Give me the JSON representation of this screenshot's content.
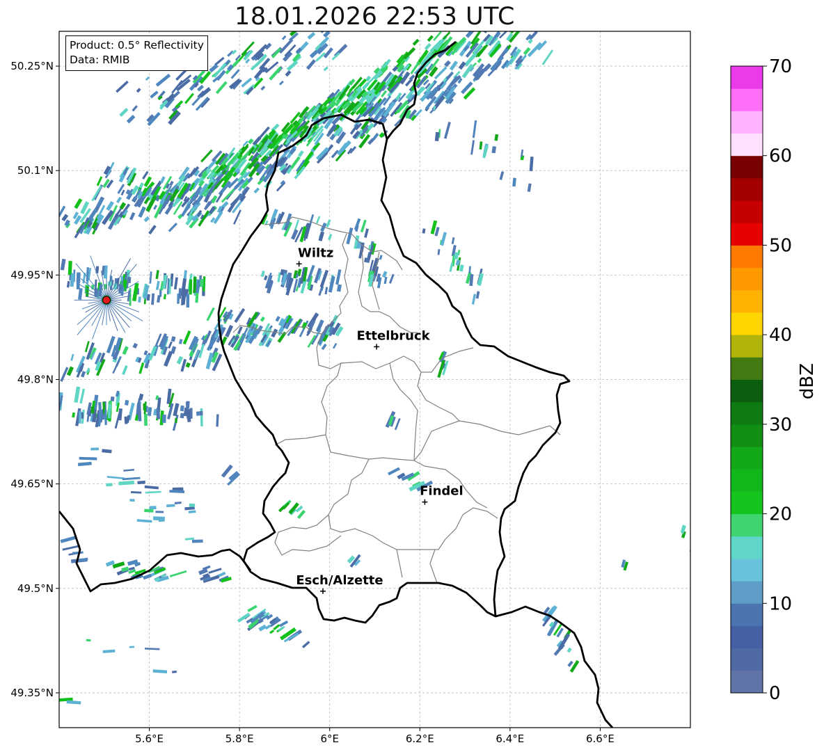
{
  "title": "18.01.2026 22:53 UTC",
  "info": {
    "product": "Product: 0.5° Reflectivity",
    "data_source": "Data: RMIB"
  },
  "map": {
    "extent": {
      "lon_min": 5.4,
      "lon_max": 6.8,
      "lat_min": 49.3,
      "lat_max": 50.3
    },
    "lon_ticks": [
      {
        "value": 5.6,
        "label": "5.6°E"
      },
      {
        "value": 5.8,
        "label": "5.8°E"
      },
      {
        "value": 6.0,
        "label": "6°E"
      },
      {
        "value": 6.2,
        "label": "6.2°E"
      },
      {
        "value": 6.4,
        "label": "6.4°E"
      },
      {
        "value": 6.6,
        "label": "6.6°E"
      }
    ],
    "lat_ticks": [
      {
        "value": 50.25,
        "label": "50.25°N"
      },
      {
        "value": 50.1,
        "label": "50.1°N"
      },
      {
        "value": 49.95,
        "label": "49.95°N"
      },
      {
        "value": 49.8,
        "label": "49.8°N"
      },
      {
        "value": 49.65,
        "label": "49.65°N"
      },
      {
        "value": 49.5,
        "label": "49.5°N"
      },
      {
        "value": 49.35,
        "label": "49.35°N"
      }
    ],
    "radar_site": {
      "lon": 5.505,
      "lat": 49.914
    },
    "cities": [
      {
        "name": "Wiltz",
        "lon": 5.932,
        "lat": 49.966
      },
      {
        "name": "Ettelbruck",
        "lon": 6.104,
        "lat": 49.847
      },
      {
        "name": "Findel",
        "lon": 6.211,
        "lat": 49.624
      },
      {
        "name": "Esch/Alzette",
        "lon": 5.985,
        "lat": 49.496
      }
    ],
    "colors": {
      "border": "#000000",
      "cantons": "#808080",
      "grid": "#bbbbbb",
      "radar_site": "#e31a1c"
    }
  },
  "colorbar": {
    "label": "dBZ",
    "min": 0,
    "max": 70,
    "tick_values": [
      0,
      10,
      20,
      30,
      40,
      50,
      60,
      70
    ],
    "colors": [
      "#6174a8",
      "#516aa3",
      "#4560a4",
      "#4a75b0",
      "#5d9dc8",
      "#68c2dc",
      "#5fd6c8",
      "#3fd470",
      "#16c41e",
      "#12b81a",
      "#12a818",
      "#118e14",
      "#0f7a12",
      "#0b5e0e",
      "#447a12",
      "#b1b40a",
      "#ffd500",
      "#ffb300",
      "#ff9900",
      "#ff7a00",
      "#e60000",
      "#c40000",
      "#a30000",
      "#780000",
      "#ffe0ff",
      "#ffb3ff",
      "#ff6ef7",
      "#ea3aea"
    ]
  },
  "echo_colors": [
    "#4a6ba4",
    "#5379b3",
    "#4f86bd",
    "#5cb1d4",
    "#5ed6c3",
    "#3ad46f",
    "#14c01c",
    "#12a818"
  ]
}
